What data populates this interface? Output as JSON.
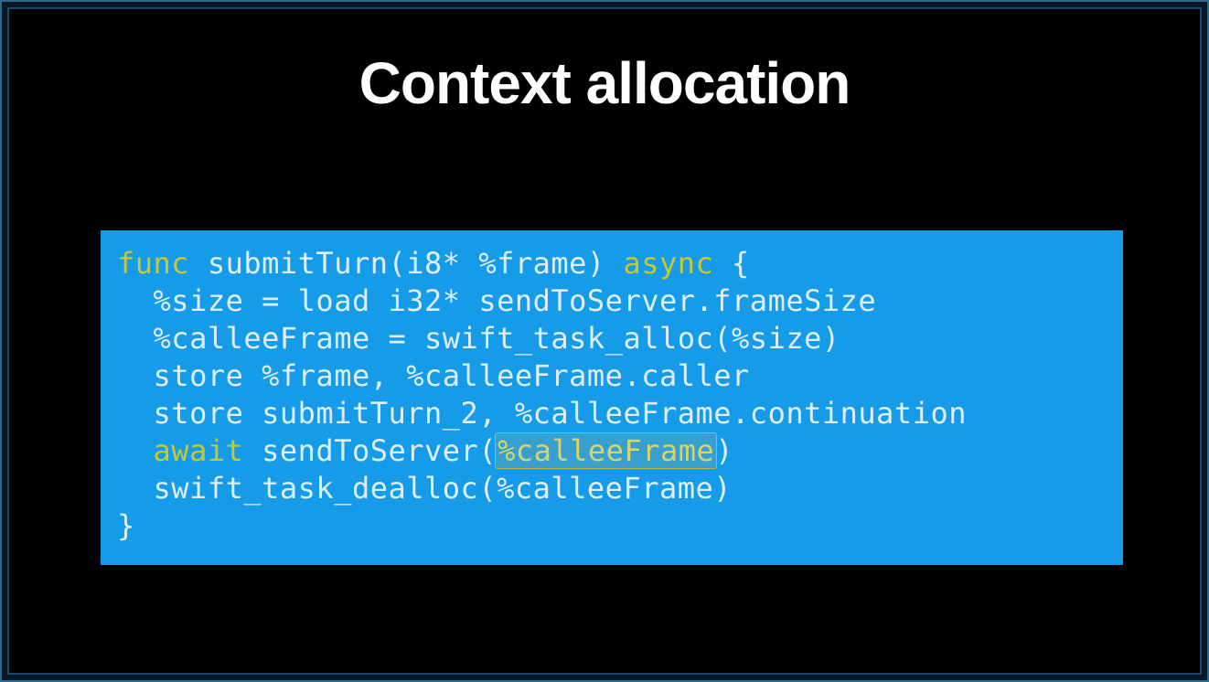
{
  "title": "Context allocation",
  "code": {
    "line1": {
      "kw_func": "func",
      "sp1": " ",
      "fname_and_args": "submitTurn(i8* %frame) ",
      "kw_async": "async",
      "sp2": " ",
      "brace_open": "{"
    },
    "line2": "  %size = load i32* sendToServer.frameSize",
    "line3": "  %calleeFrame = swift_task_alloc(%size)",
    "line4": "  store %frame, %calleeFrame.caller",
    "line5": "  store submitTurn_2, %calleeFrame.continuation",
    "line6": {
      "indent": "  ",
      "kw_await": "await",
      "sp1": " ",
      "call_open": "sendToServer(",
      "hl_arg": "%calleeFrame",
      "call_close": ")"
    },
    "line7": "  swift_task_dealloc(%calleeFrame)",
    "line8": "}"
  }
}
